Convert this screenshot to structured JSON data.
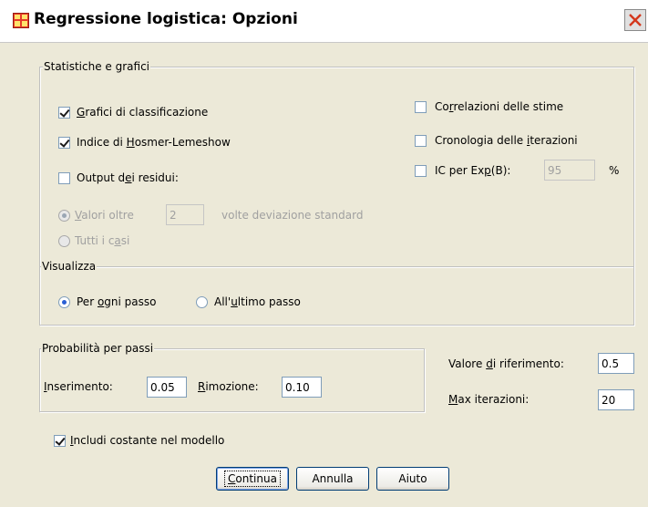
{
  "window": {
    "title": "Regressione logistica: Opzioni"
  },
  "stats_group": {
    "legend": "Statistiche e grafici",
    "classification_plots": {
      "label_pre": "",
      "label_ul": "G",
      "label_post": "rafici di classificazione",
      "checked": true
    },
    "hosmer": {
      "label_pre": "Indice di ",
      "label_ul": "H",
      "label_post": "osmer-Lemeshow",
      "checked": true
    },
    "residuals_output": {
      "label_pre": "Output d",
      "label_ul": "e",
      "label_post": "i residui:",
      "checked": false
    },
    "outliers": {
      "label_ul": "V",
      "label_post": "alori oltre",
      "value": "2",
      "suffix": "volte deviazione standard",
      "selected": true
    },
    "all_cases": {
      "label_pre": "Tutti i c",
      "label_ul": "a",
      "label_post": "si",
      "selected": false
    },
    "correlations": {
      "label_pre": "Co",
      "label_ul": "r",
      "label_post": "relazioni delle stime",
      "checked": false
    },
    "iteration_history": {
      "label_pre": "Cronologia delle ",
      "label_ul": "i",
      "label_post": "terazioni",
      "checked": false
    },
    "ci_exp": {
      "label_pre": "IC per Ex",
      "label_ul": "p",
      "label_post": "(B):",
      "value": "95",
      "unit": "%",
      "checked": false
    }
  },
  "display_group": {
    "legend": "Visualizza",
    "each_step": {
      "label_pre": "Per ",
      "label_ul": "o",
      "label_post": "gni passo",
      "selected": true
    },
    "last_step": {
      "label_pre": "All'",
      "label_ul": "u",
      "label_post": "ltimo passo",
      "selected": false
    }
  },
  "stepwise_group": {
    "legend": "Probabilità per passi",
    "entry": {
      "label_ul": "I",
      "label_post": "nserimento:",
      "value": "0.05"
    },
    "removal": {
      "label_ul": "R",
      "label_post": "imozione:",
      "value": "0.10"
    }
  },
  "classification_cutoff": {
    "label_pre": "Valore ",
    "label_ul": "d",
    "label_post": "i riferimento:",
    "value": "0.5"
  },
  "max_iterations": {
    "label_ul": "M",
    "label_post": "ax iterazioni:",
    "value": "20"
  },
  "include_constant": {
    "label_ul": "I",
    "label_post": "ncludi costante nel modello",
    "checked": true
  },
  "buttons": {
    "continue": {
      "label_pre": "",
      "label_ul": "C",
      "label_post": "ontinua"
    },
    "cancel": {
      "label": "Annulla"
    },
    "help": {
      "label": "Aiuto"
    }
  }
}
